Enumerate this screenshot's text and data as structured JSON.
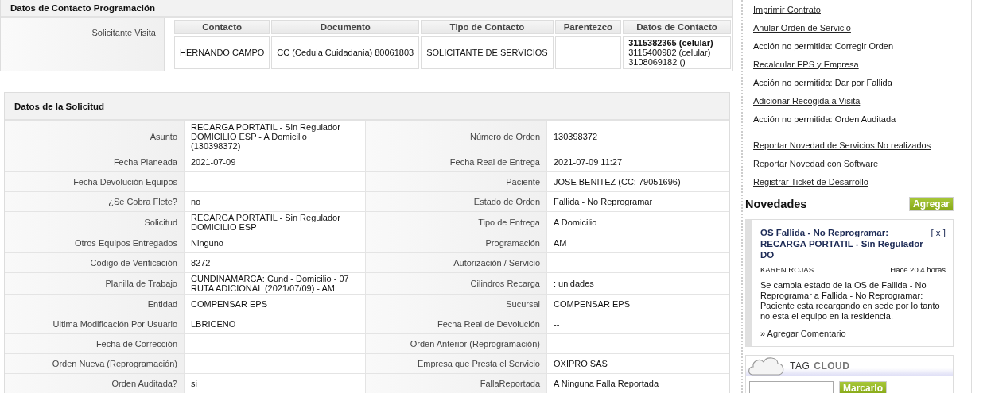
{
  "contact_section": {
    "title": "Datos de Contacto Programación",
    "row_label": "Solicitante Visita",
    "columns": [
      "Contacto",
      "Documento",
      "Tipo de Contacto",
      "Parentezco",
      "Datos de Contacto"
    ],
    "contact": {
      "name": "HERNANDO CAMPO",
      "document": "CC (Cedula Cuidadania) 80061803",
      "type": "SOLICITANTE DE SERVICIOS",
      "phones": [
        {
          "text": "3115382365 (celular)",
          "primary": true
        },
        {
          "text": "3115400982 (celular)",
          "primary": false
        },
        {
          "text": "3108069182 ()",
          "primary": false
        }
      ]
    }
  },
  "request_section": {
    "title": "Datos de la Solicitud",
    "rows": [
      {
        "left": {
          "label": "Asunto",
          "value": "RECARGA PORTATIL - Sin Regulador DOMICILIO ESP - A Domicilio (130398372)"
        },
        "right": {
          "label": "Número de Orden",
          "value": "130398372"
        }
      },
      {
        "left": {
          "label": "Fecha Planeada",
          "value": "2021-07-09"
        },
        "right": {
          "label": "Fecha Real de Entrega",
          "value": "2021-07-09 11:27"
        }
      },
      {
        "left": {
          "label": "Fecha Devolución Equipos",
          "value": "--"
        },
        "right": {
          "label": "Paciente",
          "value": "JOSE BENITEZ (CC: 79051696)"
        }
      },
      {
        "left": {
          "label": "¿Se Cobra Flete?",
          "value": "no"
        },
        "right": {
          "label": "Estado de Orden",
          "value": "Fallida - No Reprogramar"
        }
      },
      {
        "left": {
          "label": "Solicitud",
          "value": "RECARGA PORTATIL - Sin Regulador DOMICILIO ESP"
        },
        "right": {
          "label": "Tipo de Entrega",
          "value": "A Domicilio"
        }
      },
      {
        "left": {
          "label": "Otros Equipos Entregados",
          "value": "Ninguno"
        },
        "right": {
          "label": "Programación",
          "value": "AM"
        }
      },
      {
        "left": {
          "label": "Código de Verificación",
          "value": "8272"
        },
        "right": {
          "label": "Autorización / Servicio"
        }
      },
      {
        "left": {
          "label": "Planilla de Trabajo",
          "value": "CUNDINAMARCA: Cund - Domicilio - 07 RUTA ADICIONAL (2021/07/09) - AM"
        },
        "right": {
          "label": "Cilindros Recarga",
          "value": ": unidades"
        }
      },
      {
        "left": {
          "label": "Entidad",
          "value": "COMPENSAR EPS"
        },
        "right": {
          "label": "Sucursal",
          "value": "COMPENSAR EPS"
        }
      },
      {
        "left": {
          "label": "Ultima Modificación Por Usuario",
          "value": "LBRICENO"
        },
        "right": {
          "label": "Fecha Real de Devolución",
          "value": "--"
        }
      },
      {
        "left": {
          "label": "Fecha de Corrección",
          "value": "--"
        },
        "right": {
          "label": "Orden Anterior (Reprogramación)"
        }
      },
      {
        "left": {
          "label": "Orden Nueva (Reprogramación)"
        },
        "right": {
          "label": "Empresa que Presta el Servicio",
          "value": "OXIPRO SAS"
        }
      },
      {
        "left": {
          "label": "Orden Auditada?",
          "value": "si"
        },
        "right": {
          "label": "FallaReportada",
          "value": "A Ninguna Falla Reportada"
        }
      }
    ]
  },
  "actions": [
    {
      "kind": "link",
      "text": "Imprimir Contrato"
    },
    {
      "kind": "link",
      "text": "Anular Orden de Servicio"
    },
    {
      "kind": "text",
      "text": "Acción no permitida: Corregir Orden"
    },
    {
      "kind": "link",
      "text": "Recalcular EPS y Empresa"
    },
    {
      "kind": "text",
      "text": "Acción no permitida: Dar por Fallida"
    },
    {
      "kind": "link",
      "text": "Adicionar Recogida a Visita"
    },
    {
      "kind": "text",
      "text": "Acción no permitida: Orden Auditada"
    },
    {
      "kind": "separator"
    },
    {
      "kind": "link",
      "text": "Reportar Novedad de Servicios No realizados"
    },
    {
      "kind": "link",
      "text": "Reportar Novedad con Software"
    },
    {
      "kind": "link",
      "text": "Registrar Ticket de Desarrollo"
    }
  ],
  "news": {
    "title": "Novedades",
    "add_button": "Agregar",
    "items": [
      {
        "title": "OS Fallida - No Reprogramar: RECARGA PORTATIL - Sin Regulador DO",
        "close": "[ x ]",
        "author": "KAREN ROJAS",
        "time": "Hace 20.4 horas",
        "body": "Se cambia estado de la OS de Fallida - No Reprogramar a Fallida - No Reprogramar: Paciente esta recargando en sede por lo tanto no esta el equipo en la residencia.",
        "comment_link": "» Agregar Comentario"
      }
    ]
  },
  "tag_cloud": {
    "title_word_1": "TAG",
    "title_word_2": "CLOUD",
    "button": "Marcarlo"
  }
}
